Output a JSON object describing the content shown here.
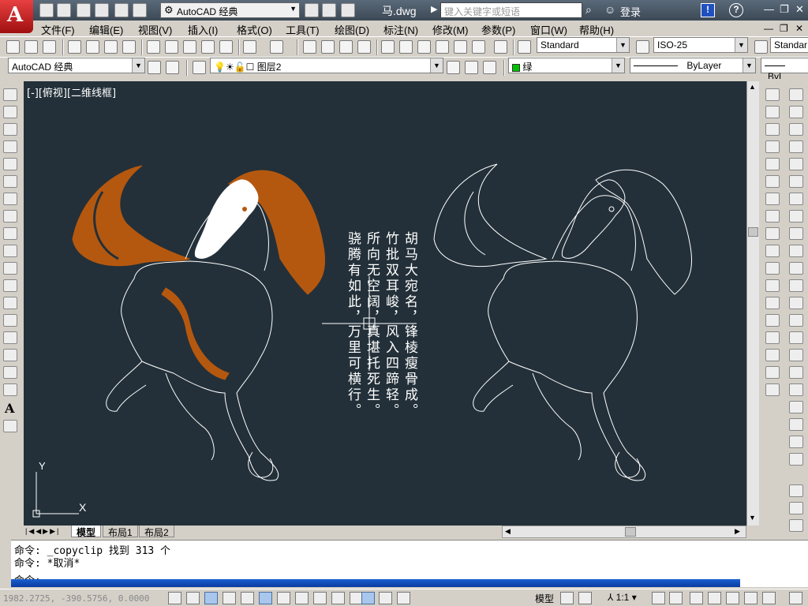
{
  "titlebar": {
    "workspace": "AutoCAD 经典",
    "document_title": "马.dwg",
    "search_placeholder": "键入关键字或短语",
    "login": "登录"
  },
  "menu": [
    "文件(F)",
    "编辑(E)",
    "视图(V)",
    "插入(I)",
    "格式(O)",
    "工具(T)",
    "绘图(D)",
    "标注(N)",
    "修改(M)",
    "参数(P)",
    "窗口(W)",
    "帮助(H)"
  ],
  "toolbar1": {
    "text_style": "Standard",
    "dim_style": "ISO-25",
    "table_style": "Standar"
  },
  "toolbar2": {
    "workspace": "AutoCAD 经典",
    "layer": "图层2",
    "color": "绿",
    "color_swatch": "#00c000",
    "linetype": "ByLayer",
    "lineweight": "ByL"
  },
  "drawing": {
    "view_label": "[-][俯视][二维线框]",
    "background": "#233039",
    "accent_fill": "#b5580f",
    "poem_columns": [
      "胡马大宛名，",
      "锋棱瘦骨成。",
      "竹批双耳峻，",
      "风入四蹄轻。",
      "所向无空阔，",
      "真堪托死生。",
      "骁腾有如此，",
      "万里可横行。"
    ],
    "ucs_x": "X",
    "ucs_y": "Y"
  },
  "layout_tabs": [
    "模型",
    "布局1",
    "布局2"
  ],
  "command": {
    "line1": "命令: _copyclip 找到 313 个",
    "line2": "命令: *取消*",
    "line3": "命令:"
  },
  "statusbar": {
    "coords": "1982.2725, -390.5756, 0.0000",
    "model_label": "模型",
    "annotation_scale": "1:1"
  }
}
